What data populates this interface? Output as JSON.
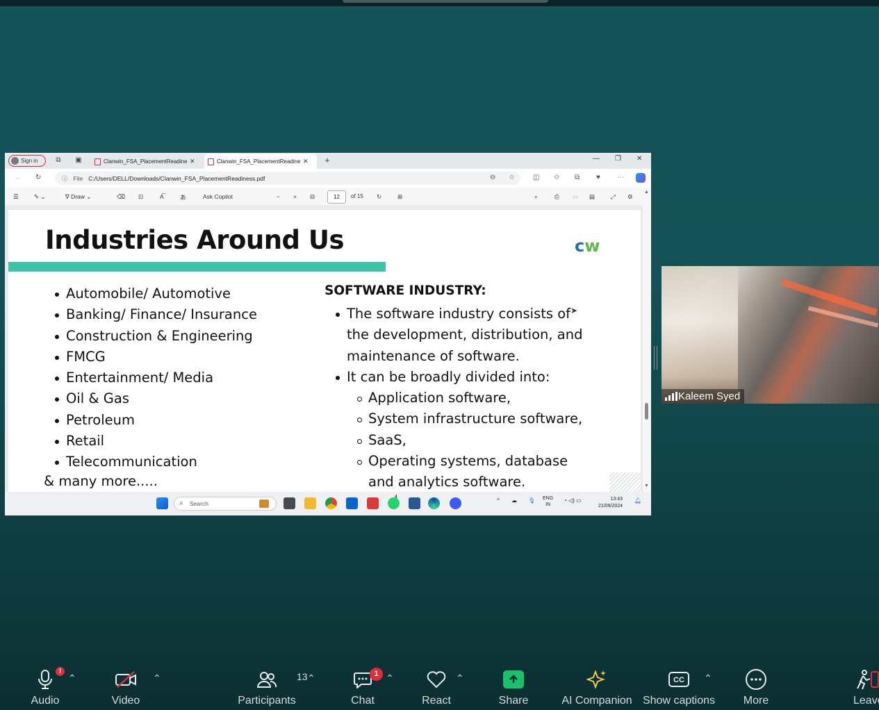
{
  "browser": {
    "signin_label": "Sign in",
    "tabs": [
      {
        "label": "Clanwin_FSA_PlacementReadiness.pdf",
        "active": false
      },
      {
        "label": "Clanwin_FSA_PlacementReadiness.pdf",
        "active": true
      }
    ],
    "new_tab": "+",
    "address_prefix": "File",
    "address": "C:/Users/DELL/Downloads/Clanwin_FSA_PlacementReadiness.pdf"
  },
  "pdf_toolbar": {
    "draw_label": "Draw",
    "ask_copilot_label": "Ask Copilot",
    "page_number": "12",
    "page_total": "of 15"
  },
  "slide": {
    "title": "Industries Around Us",
    "logo_c": "c",
    "logo_w": "w",
    "industries": [
      "Automobile/ Automotive",
      "Banking/ Finance/ Insurance",
      "Construction & Engineering",
      "FMCG",
      "Entertainment/ Media",
      "Oil & Gas",
      "Petroleum",
      "Retail",
      "Telecommunication"
    ],
    "more": "& many more.....",
    "software_heading": "SOFTWARE INDUSTRY:",
    "software_point1": "The software industry consists of the development, distribution, and maintenance of software.",
    "software_point2": "It can be broadly divided into:",
    "software_types": [
      "Application software,",
      "System infrastructure software,",
      "SaaS,",
      "Operating systems, database",
      "and analytics software."
    ]
  },
  "taskbar": {
    "search_placeholder": "Search",
    "lang_top": "ENG",
    "lang_bottom": "IN",
    "time": "13:43",
    "date": "21/09/2024",
    "whatsapp_badge": "4"
  },
  "participant": {
    "name": "Kaleem Syed"
  },
  "zoom_toolbar": {
    "audio_label": "Audio",
    "video_label": "Video",
    "participants_label": "Participants",
    "participants_count": "13",
    "chat_label": "Chat",
    "chat_badge": "1",
    "react_label": "React",
    "share_label": "Share",
    "ai_label": "AI Companion",
    "captions_label": "Show captions",
    "more_label": "More",
    "leave_label": "Leave",
    "audio_badge": "!"
  },
  "colors": {
    "accent_teal": "#3ec4a8",
    "share_green": "#19c26a",
    "badge_red": "#e02d3c",
    "ai_yellow": "#f2c94c"
  }
}
